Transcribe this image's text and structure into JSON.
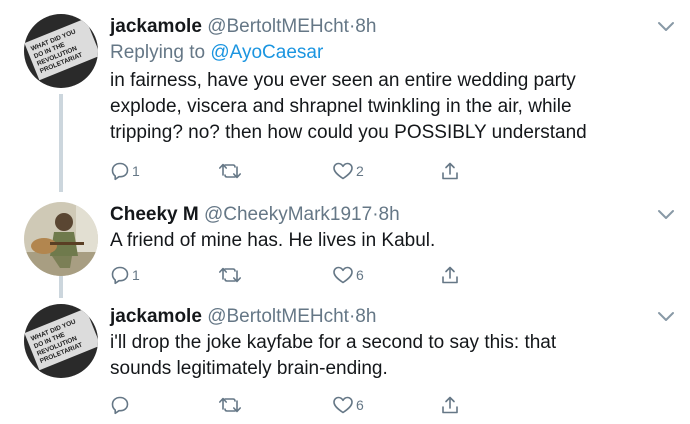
{
  "tweets": [
    {
      "name": "jackamole",
      "handle": "@BertoltMEHcht",
      "dot": "·",
      "time": "8h",
      "replying_prefix": "Replying to ",
      "replying_to": "@AyoCaesar",
      "lines": [
        "in fairness, have you ever seen an entire wedding party",
        "explode, viscera and shrapnel twinkling in the air, while",
        "tripping? no? then how could you POSSIBLY understand"
      ],
      "reply_count": "1",
      "retweet_count": "",
      "like_count": "2"
    },
    {
      "name": "Cheeky M",
      "handle": "@CheekyMark1917",
      "dot": "·",
      "time": "8h",
      "lines": [
        "A friend of mine has. He lives in Kabul."
      ],
      "reply_count": "1",
      "retweet_count": "",
      "like_count": "6"
    },
    {
      "name": "jackamole",
      "handle": "@BertoltMEHcht",
      "dot": "·",
      "time": "8h",
      "lines": [
        "i'll drop the joke kayfabe for a second to say this: that",
        "sounds legitimately brain-ending."
      ],
      "reply_count": "",
      "retweet_count": "",
      "like_count": "6"
    }
  ],
  "avatar_text": [
    "WHAT DID YOU",
    "DO IN THE",
    "REVOLUTION",
    "PROLETARIAT"
  ],
  "colors": {
    "text": "#14171a",
    "secondary": "#657786",
    "link": "#1b95e0",
    "thread_line": "#ccd6dd"
  },
  "icons": [
    "reply-icon",
    "retweet-icon",
    "like-icon",
    "share-icon",
    "chevron-down-icon"
  ]
}
